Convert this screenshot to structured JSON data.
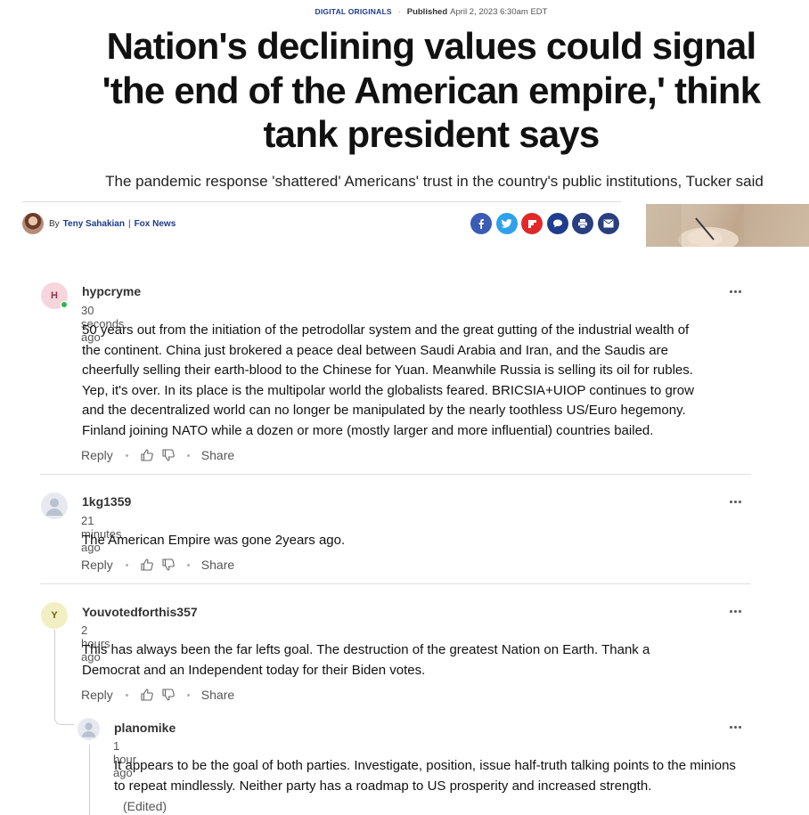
{
  "article": {
    "category": "DIGITAL ORIGINALS",
    "separator": "·",
    "published_label": "Published",
    "published_date": "April 2, 2023 6:30am EDT",
    "headline": "Nation's declining values could signal 'the end of the American empire,' think tank president says",
    "subheadline": "The pandemic response 'shattered' Americans' trust in the country's public institutions, Tucker said",
    "byline": {
      "by": "By",
      "author": "Teny Sahakian",
      "pipe": "|",
      "outlet": "Fox News"
    },
    "share_icons": [
      "facebook-icon",
      "twitter-icon",
      "flipboard-icon",
      "comments-icon",
      "print-icon",
      "email-icon"
    ],
    "colors": {
      "brand_blue": "#1f3a8a",
      "facebook": "#3b5cb5",
      "twitter": "#2ea1ec",
      "flipboard": "#e12828"
    }
  },
  "comments": [
    {
      "initial": "H",
      "username": "hypcryme",
      "time": "30 seconds ago",
      "online": true,
      "body_lines": [
        "50 years out from the initiation of the petrodollar system and the great gutting of the industrial wealth of",
        "the continent. China just brokered a peace deal between Saudi Arabia and Iran, and the Saudis are",
        "cheerfully selling their earth-blood to the Chinese for Yuan. Meanwhile Russia is selling its oil for rubles.",
        "Yep, it's over.  In its place is the multipolar world the globalists feared.  BRICSIA+UIOP continues to grow",
        "and the decentralized world can no longer be manipulated by the nearly toothless US/Euro hegemony.",
        "Finland joining NATO while a dozen or more (mostly larger and more influential) countries bailed."
      ],
      "actions": {
        "reply": "Reply",
        "share": "Share"
      }
    },
    {
      "initial": "",
      "username": "1kg1359",
      "time": "21 minutes ago",
      "online": false,
      "body_lines": [
        "The American Empire was gone 2years ago."
      ],
      "actions": {
        "reply": "Reply",
        "share": "Share"
      }
    },
    {
      "initial": "Y",
      "username": "Youvotedforthis357",
      "time": "2 hours ago",
      "online": false,
      "body_lines": [
        "This has always been the far lefts goal. The destruction of the greatest Nation on Earth. Thank a",
        "Democrat and an Independent today for their Biden votes."
      ],
      "actions": {
        "reply": "Reply",
        "share": "Share"
      }
    },
    {
      "initial": "",
      "username": "planomike",
      "time": "1 hour ago",
      "online": false,
      "body_lines": [
        "It appears to be the goal of both parties. Investigate, position, issue half-truth talking points to the minions",
        "to repeat mindlessly. Neither party has a roadmap to US prosperity and increased strength."
      ],
      "edited": "(Edited)"
    }
  ]
}
